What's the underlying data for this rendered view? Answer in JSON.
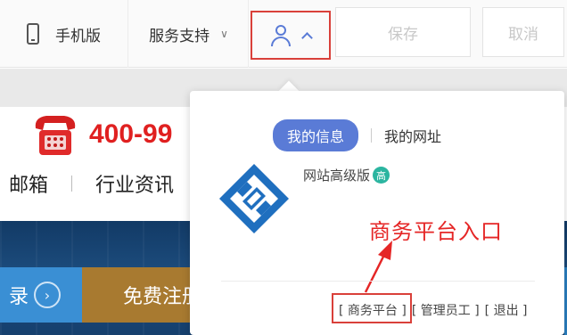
{
  "toolbar": {
    "mobile_label": "手机版",
    "service_label": "服务支持",
    "save_label": "保存",
    "cancel_label": "取消"
  },
  "site": {
    "hotline": "400-99",
    "nav": [
      "邮箱",
      "行业资讯"
    ],
    "banner_login": "录",
    "banner_register": "免费注册"
  },
  "panel": {
    "tab_active": "我的信息",
    "tab_other": "我的网址",
    "version": "网站高级版",
    "version_badge": "高",
    "annotation": "商务平台入口",
    "links": [
      "[ 商务平台 ]",
      "[ 管理员工 ]",
      "[ 退出 ]"
    ]
  },
  "colors": {
    "accent": "#5a7bd6",
    "highlight_red": "#d9403a",
    "hotline_red": "#e02020",
    "logo_blue": "#1f6fbf"
  },
  "icons": {
    "mobile": "phone-icon",
    "service": "chevron-down-icon",
    "user": "user-icon",
    "user_chevron": "chevron-up-icon"
  }
}
